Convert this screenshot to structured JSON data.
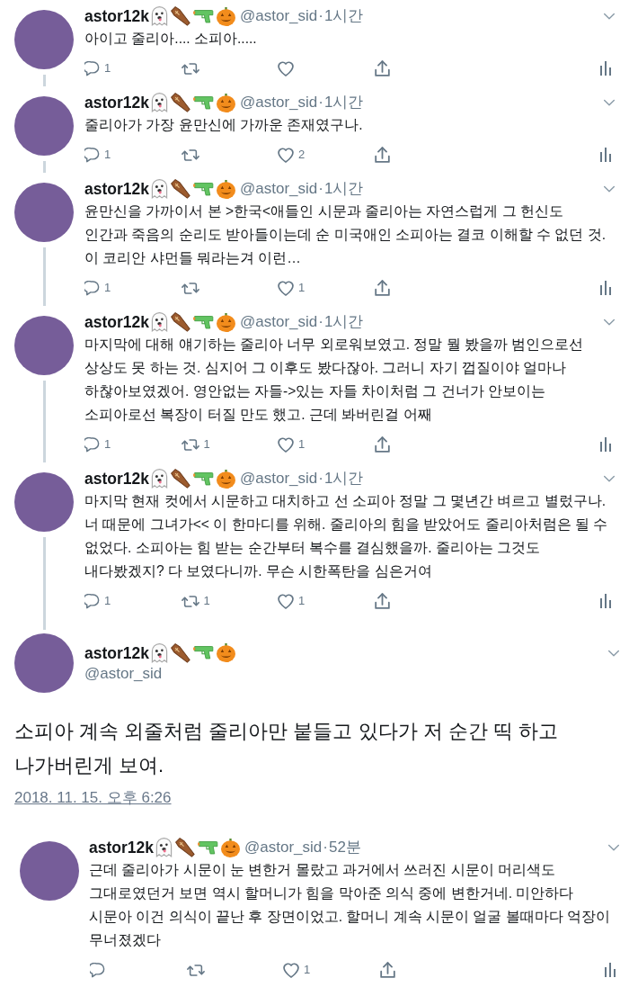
{
  "separator": "·",
  "tweets": [
    {
      "kind": "thread",
      "name": "astor12k",
      "handle": "@astor_sid",
      "time": "1시간",
      "text": "아이고 줄리아.... 소피아.....",
      "reply_count": "1"
    },
    {
      "kind": "thread",
      "name": "astor12k",
      "handle": "@astor_sid",
      "time": "1시간",
      "text": "줄리아가 가장 윤만신에 가까운 존재였구나.",
      "reply_count": "1",
      "like_count": "2"
    },
    {
      "kind": "thread",
      "name": "astor12k",
      "handle": "@astor_sid",
      "time": "1시간",
      "text": "윤만신을 가까이서 본 >한국<애들인 시문과 줄리아는 자연스럽게 그 헌신도 인간과 죽음의 순리도 받아들이는데 순 미국애인 소피아는 결코 이해할 수 없던 것. 이 코리안 샤먼들 뭐라는겨 이런…",
      "reply_count": "1",
      "like_count": "1"
    },
    {
      "kind": "thread",
      "name": "astor12k",
      "handle": "@astor_sid",
      "time": "1시간",
      "text": "마지막에 대해 얘기하는 줄리아 너무 외로워보였고. 정말 뭘 봤을까 범인으로선 상상도 못 하는 것. 심지어 그 이후도 봤다잖아. 그러니 자기 껍질이야 얼마나 하찮아보였겠어. 영안없는 자들->있는 자들 차이처럼 그 건너가 안보이는 소피아로선 복장이 터질 만도 했고. 근데 봐버린걸 어째",
      "reply_count": "1",
      "retweet_count": "1",
      "like_count": "1"
    },
    {
      "kind": "thread",
      "name": "astor12k",
      "handle": "@astor_sid",
      "time": "1시간",
      "text": "마지막 현재 컷에서 시문하고 대치하고 선 소피아 정말 그 몇년간 벼르고 별렀구나. 너 때문에 그녀가<< 이 한마디를 위해. 줄리아의 힘을 받았어도 줄리아처럼은 될 수 없었다. 소피아는 힘 받는 순간부터 복수를 결심했을까. 줄리아는 그것도 내다봤겠지? 다 보였다니까. 무슨 시한폭탄을 심은거여",
      "reply_count": "1",
      "retweet_count": "1",
      "like_count": "1"
    },
    {
      "kind": "focus",
      "name": "astor12k",
      "handle": "@astor_sid",
      "text": "소피아 계속 외줄처럼 줄리아만 붙들고 있다가 저 순간 띡 하고 나가버린게 보여.",
      "timestamp": "2018. 11. 15. 오후 6:26"
    },
    {
      "kind": "reply",
      "name": "astor12k",
      "handle": "@astor_sid",
      "time": "52분",
      "text": "근데 줄리아가 시문이 눈 변한거 몰랐고 과거에서 쓰러진 시문이 머리색도 그대로였던거 보면 역시 할머니가 힘을 막아준 의식 중에 변한거네. 미안하다 시문아 이건 의식이 끝난 후 장면이었고. 할머니 계속 시문이 얼굴 볼때마다 억장이 무너졌겠다",
      "like_count": "1"
    }
  ]
}
